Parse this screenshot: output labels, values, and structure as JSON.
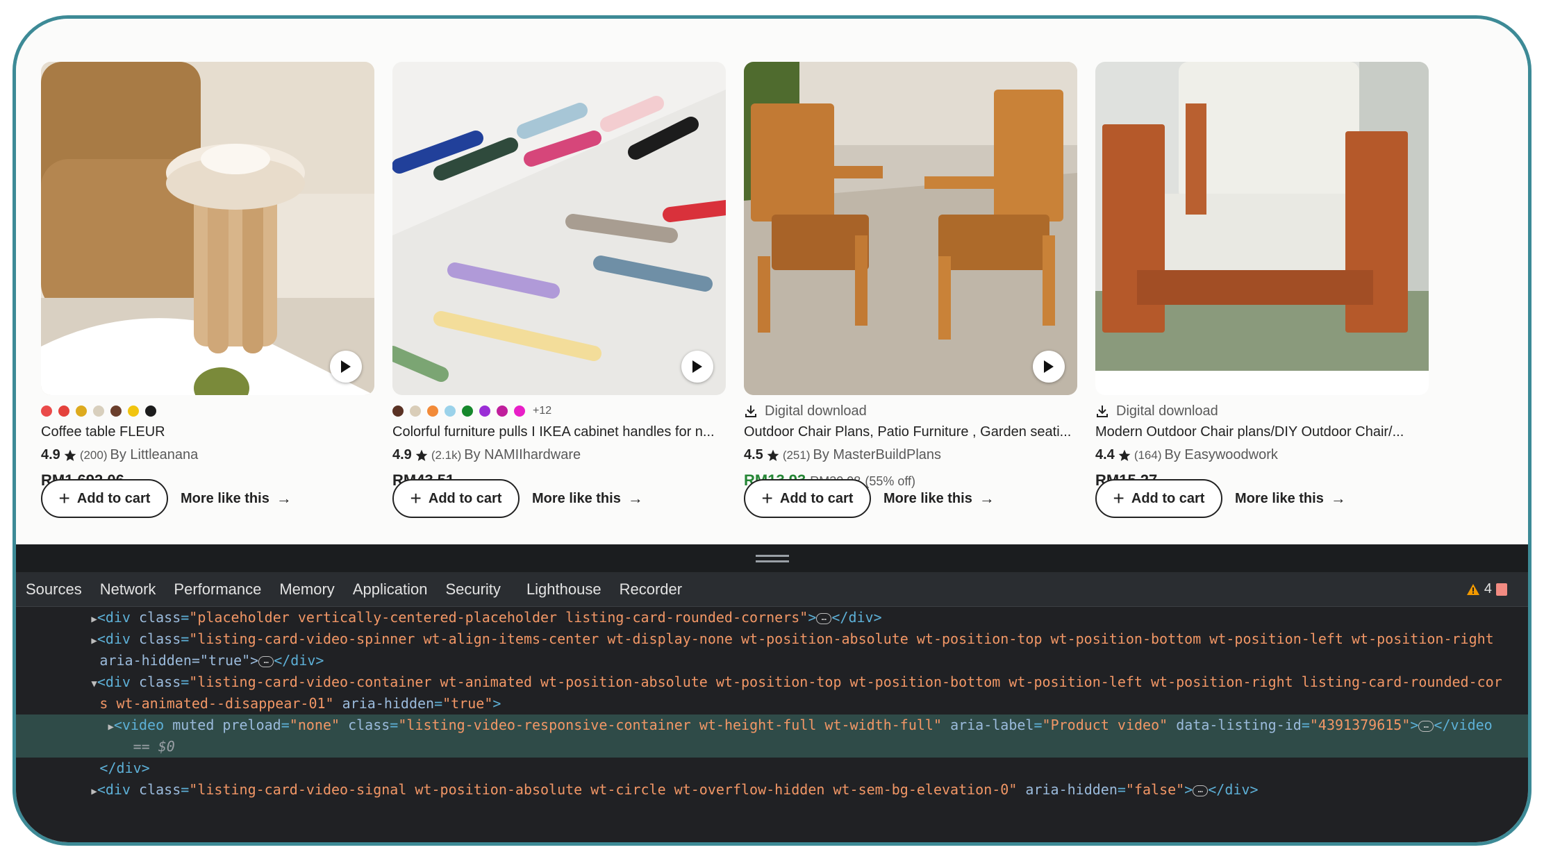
{
  "products": [
    {
      "title": "Coffee table FLEUR",
      "rating": "4.9",
      "reviews": "(200)",
      "shop": "By Littleanana",
      "price": "RM1,692.06",
      "color_swatches": [
        "#ea4a4a",
        "#e4423c",
        "#ddaa1e",
        "#d8cfbd",
        "#6b3f2c",
        "#f1c40f",
        "#1c1c1c"
      ],
      "has_video": true,
      "add_to_cart": "Add to cart",
      "more_like_this": "More like this"
    },
    {
      "title": "Colorful furniture pulls I IKEA cabinet handles for n...",
      "rating": "4.9",
      "reviews": "(2.1k)",
      "shop": "By NAMIIhardware",
      "price": "RM43.51",
      "color_swatches": [
        "#5a3224",
        "#d9cdb8",
        "#f28a38",
        "#9bd2ea",
        "#16882c",
        "#9a2ed6",
        "#c01e9c",
        "#e81fc7"
      ],
      "more_swatches": "+12",
      "has_video": true,
      "add_to_cart": "Add to cart",
      "more_like_this": "More like this"
    },
    {
      "badge": "Digital download",
      "title": "Outdoor Chair Plans, Patio Furniture , Garden seati...",
      "rating": "4.5",
      "reviews": "(251)",
      "shop": "By MasterBuildPlans",
      "price": "RM13.93",
      "original_price": "RM30.98",
      "discount": "(55% off)",
      "has_video": true,
      "add_to_cart": "Add to cart",
      "more_like_this": "More like this"
    },
    {
      "badge": "Digital download",
      "title": "Modern Outdoor Chair plans/DIY Outdoor Chair/...",
      "rating": "4.4",
      "reviews": "(164)",
      "shop": "By Easywoodwork",
      "price": "RM15.27",
      "has_video": false,
      "add_to_cart": "Add to cart",
      "more_like_this": "More like this"
    }
  ],
  "devtools": {
    "tabs": [
      "Sources",
      "Network",
      "Performance",
      "Memory",
      "Application",
      "Security",
      "Lighthouse",
      "Recorder"
    ],
    "warning_count": "4",
    "code": {
      "l1_class": "\"placeholder vertically-centered-placeholder listing-card-rounded-corners\"",
      "l2_class": "\"listing-card-video-spinner wt-align-items-center wt-display-none wt-position-absolute wt-position-top wt-position-bottom wt-position-left wt-position-right",
      "l2b": "aria-hidden=\"true\">",
      "l3_class": "\"listing-card-video-container wt-animated wt-position-absolute wt-position-top wt-position-bottom wt-position-left wt-position-right listing-card-rounded-cor",
      "l3b_prefix": "s wt-animated--disappear-01\"",
      "l3b_aria": "\"true\"",
      "l4_preload": "\"none\"",
      "l4_class": "\"listing-video-responsive-container wt-height-full wt-width-full\"",
      "l4_aria": "\"Product video\"",
      "l4_lid": "\"4391379615\"",
      "l4_end": "</video",
      "l4b": "== $0",
      "l5": "</div>",
      "l6_class": "\"listing-card-video-signal wt-position-absolute wt-circle wt-overflow-hidden wt-sem-bg-elevation-0\"",
      "l6_aria": "\"false\""
    }
  }
}
